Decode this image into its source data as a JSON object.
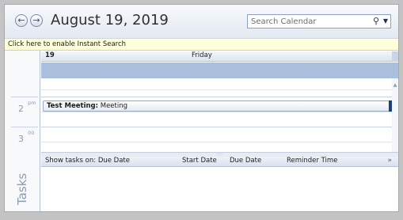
{
  "header": {
    "date_title": "August 19, 2019",
    "search_placeholder": "Search Calendar"
  },
  "instant_search": "Click here to enable Instant Search",
  "day": {
    "number": "19",
    "name": "Friday"
  },
  "time_slots": [
    {
      "hour": "2",
      "suffix": "pm"
    },
    {
      "hour": "3",
      "suffix": "00"
    }
  ],
  "appointment": {
    "title": "Test Meeting:",
    "location": "Meeting"
  },
  "tasks": {
    "label": "Tasks",
    "columns": [
      "Show tasks on: Due Date",
      "Start Date",
      "Due Date",
      "Reminder Time"
    ]
  },
  "icons": {
    "back": "back-arrow-icon",
    "forward": "forward-arrow-icon",
    "search": "search-icon",
    "dropdown": "dropdown-arrow-icon",
    "scroll_up": "scroll-up-icon",
    "expand": "double-chevron-down-icon"
  }
}
